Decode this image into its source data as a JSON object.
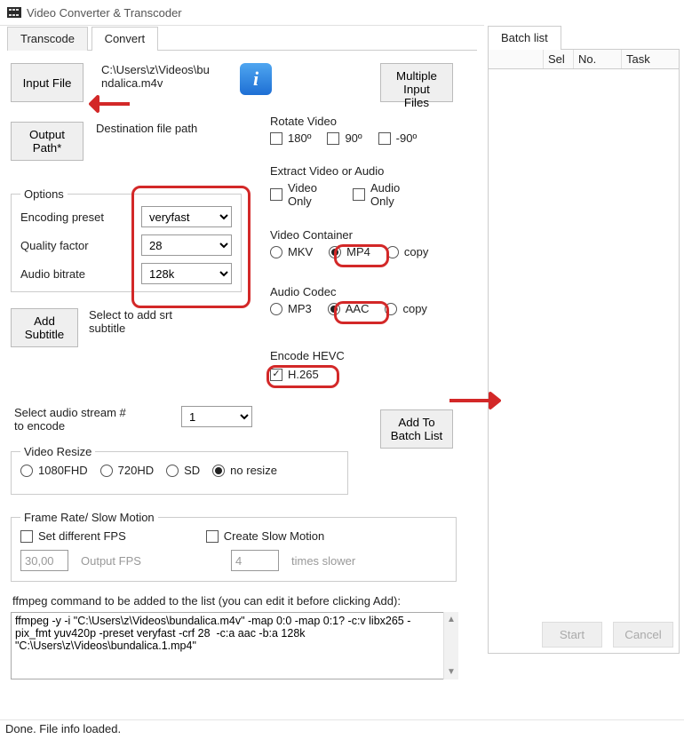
{
  "window": {
    "title": "Video Converter & Transcoder"
  },
  "tabs": {
    "transcode": "Transcode",
    "convert": "Convert",
    "active": "convert"
  },
  "batch": {
    "tab": "Batch list",
    "columns": {
      "sel": "Sel",
      "no": "No.",
      "task": "Task"
    },
    "start": "Start",
    "cancel": "Cancel"
  },
  "buttons": {
    "input_file": "Input File",
    "output_path": "Output\nPath*",
    "multiple_input": "Multiple\nInput Files",
    "add_subtitle": "Add\nSubtitle",
    "add_to_batch": "Add To\nBatch List"
  },
  "labels": {
    "input_path": "C:\\Users\\z\\Videos\\bu\nndalica.m4v",
    "dest_path": "Destination file path",
    "options": "Options",
    "encoding_preset": "Encoding preset",
    "quality_factor": "Quality factor",
    "audio_bitrate": "Audio bitrate",
    "subtitle_hint": "Select to add srt subtitle",
    "rotate_video": "Rotate Video",
    "rotate_180": "180º",
    "rotate_90": "90º",
    "rotate_neg90": "-90º",
    "extract": "Extract Video or Audio",
    "video_only": "Video\nOnly",
    "audio_only": "Audio\nOnly",
    "video_container": "Video Container",
    "mkv": "MKV",
    "mp4": "MP4",
    "copy": "copy",
    "audio_codec": "Audio Codec",
    "mp3": "MP3",
    "aac": "AAC",
    "encode_hevc": "Encode HEVC",
    "h265": "H.265",
    "audio_stream_select": "Select audio stream # to encode",
    "video_resize": "Video Resize",
    "r_1080": "1080FHD",
    "r_720": "720HD",
    "r_sd": "SD",
    "r_none": "no resize",
    "frame_slow": "Frame Rate/ Slow Motion",
    "set_fps": "Set different FPS",
    "output_fps": "Output FPS",
    "create_slow": "Create Slow Motion",
    "times_slower": "times slower",
    "cmd_label": "ffmpeg command to be added to the list (you can edit it before clicking Add):"
  },
  "values": {
    "encoding_preset": "veryfast",
    "quality_factor": "28",
    "audio_bitrate": "128k",
    "audio_stream": "1",
    "fps": "30,00",
    "slow_factor": "4",
    "cmd": "ffmpeg -y -i \"C:\\Users\\z\\Videos\\bundalica.m4v\" -map 0:0 -map 0:1? -c:v libx265 -pix_fmt yuv420p -preset veryfast -crf 28  -c:a aac -b:a 128k \"C:\\Users\\z\\Videos\\bundalica.1.mp4\""
  },
  "status": "Done. File info loaded."
}
